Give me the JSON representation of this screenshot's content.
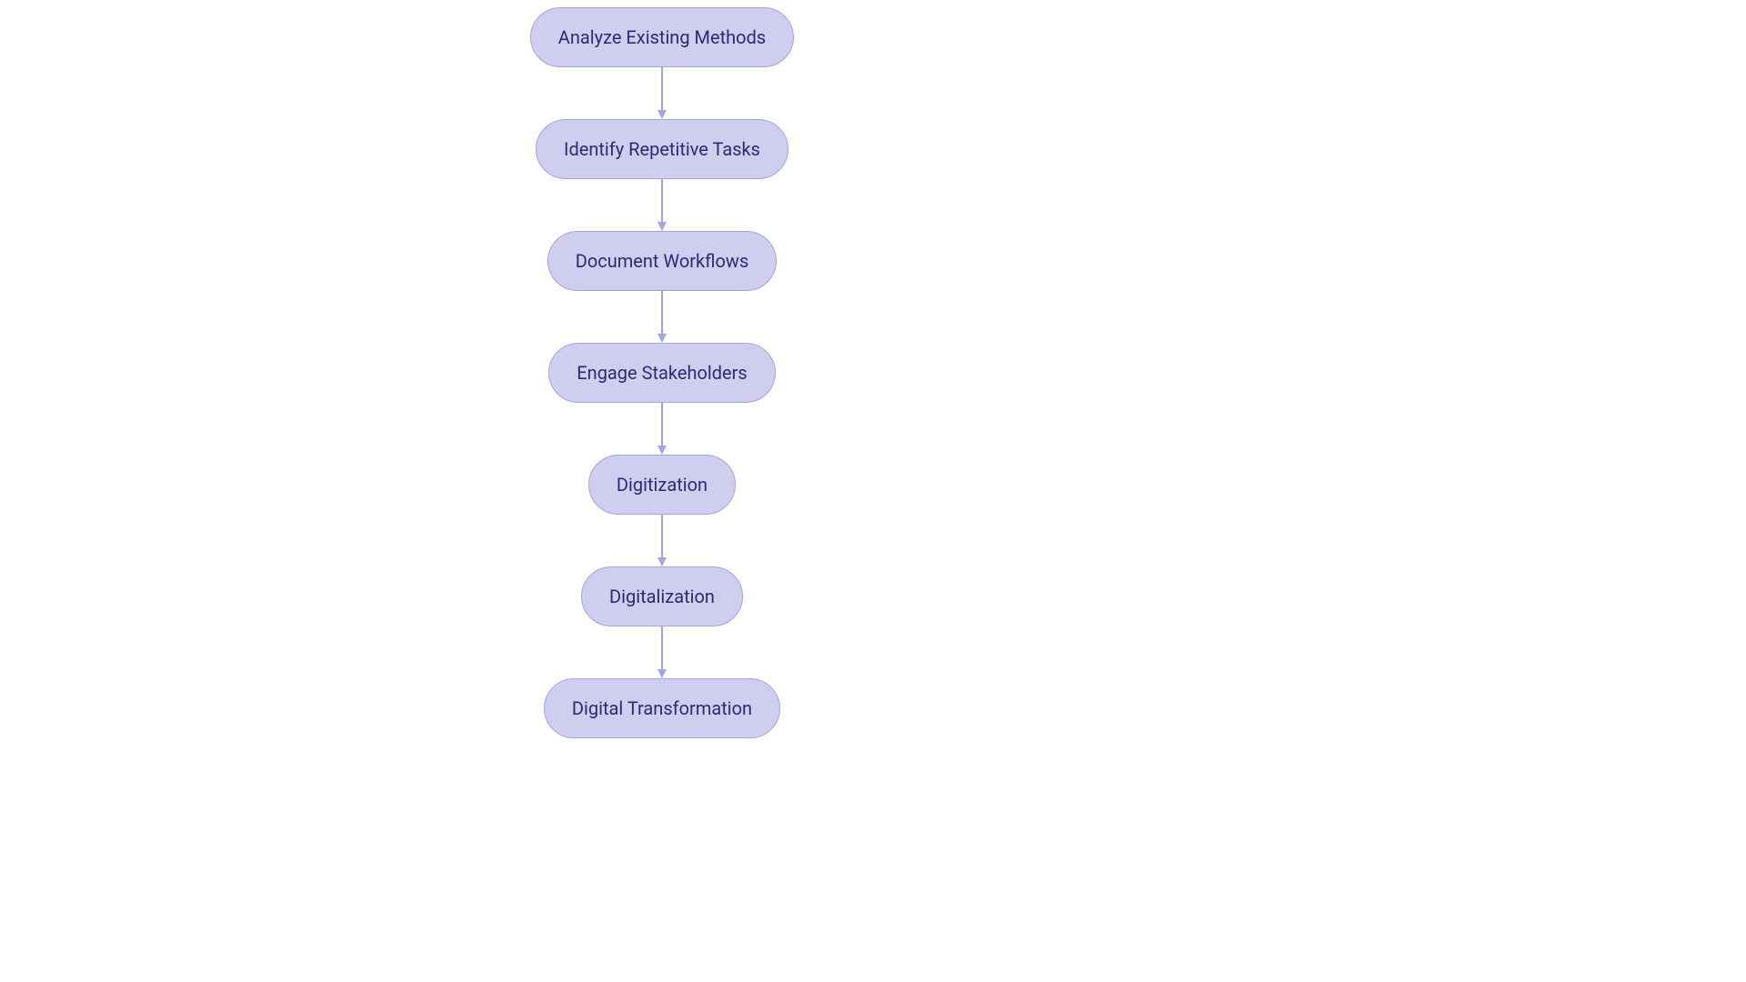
{
  "chart_data": {
    "type": "flowchart",
    "direction": "top-to-bottom",
    "nodes": [
      {
        "id": "n1",
        "label": "Analyze Existing Methods"
      },
      {
        "id": "n2",
        "label": "Identify Repetitive Tasks"
      },
      {
        "id": "n3",
        "label": "Document Workflows"
      },
      {
        "id": "n4",
        "label": "Engage Stakeholders"
      },
      {
        "id": "n5",
        "label": "Digitization"
      },
      {
        "id": "n6",
        "label": "Digitalization"
      },
      {
        "id": "n7",
        "label": "Digital Transformation"
      }
    ],
    "edges": [
      {
        "from": "n1",
        "to": "n2"
      },
      {
        "from": "n2",
        "to": "n3"
      },
      {
        "from": "n3",
        "to": "n4"
      },
      {
        "from": "n4",
        "to": "n5"
      },
      {
        "from": "n5",
        "to": "n6"
      },
      {
        "from": "n6",
        "to": "n7"
      }
    ],
    "style": {
      "node_fill": "#cfceef",
      "node_stroke": "#a5a3e2",
      "node_text": "#2b2a77",
      "arrow_stroke": "#a5a3e2",
      "arrow_fill": "#a5a3e2"
    },
    "layout": {
      "centerX": 728,
      "topY": 8,
      "nodeHeight": 66,
      "verticalGap": 123
    }
  }
}
